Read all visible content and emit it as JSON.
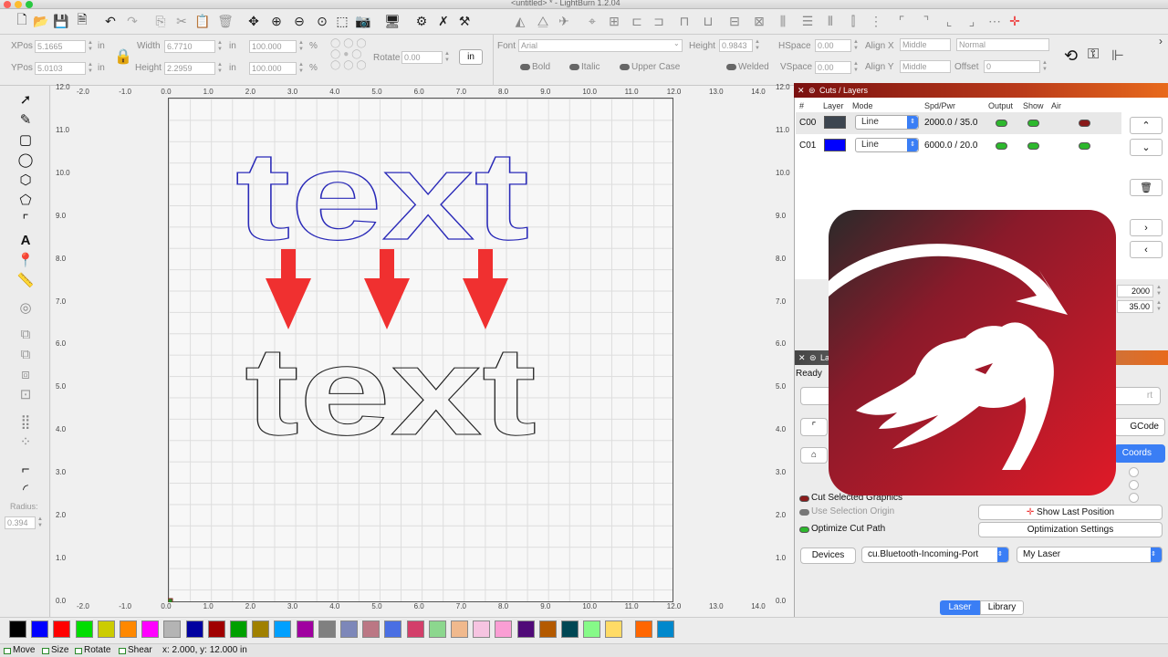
{
  "window": {
    "title": "<untitled> * - LightBurn 1.2.04"
  },
  "toolbar2": {
    "xpos_label": "XPos",
    "xpos_value": "5.1665",
    "ypos_label": "YPos",
    "ypos_value": "5.0103",
    "unit": "in",
    "width_label": "Width",
    "width_value": "6.7710",
    "height_label": "Height",
    "height_value": "2.2959",
    "pct1": "100.000",
    "pct2": "100.000",
    "pct_sign": "%",
    "rotate_label": "Rotate",
    "rotate_value": "0.00",
    "unit_button": "in",
    "font_label": "Font",
    "font_value": "Arial",
    "fheight_label": "Height",
    "fheight_value": "0.9843",
    "hspace_label": "HSpace",
    "hspace_value": "0.00",
    "vspace_label": "VSpace",
    "vspace_value": "0.00",
    "alignx_label": "Align X",
    "alignx_value": "Middle",
    "aligny_label": "Align Y",
    "aligny_value": "Middle",
    "normal_value": "Normal",
    "offset_label": "Offset",
    "offset_value": "0",
    "bold_label": "Bold",
    "italic_label": "Italic",
    "upper_label": "Upper Case",
    "welded_label": "Welded"
  },
  "rulers": {
    "top": [
      "-2.0",
      "-1.0",
      "0.0",
      "1.0",
      "2.0",
      "3.0",
      "4.0",
      "5.0",
      "6.0",
      "7.0",
      "8.0",
      "9.0",
      "10.0",
      "11.0",
      "12.0",
      "13.0",
      "14.0"
    ],
    "left": [
      "12.0",
      "11.0",
      "10.0",
      "9.0",
      "8.0",
      "7.0",
      "6.0",
      "5.0",
      "4.0",
      "3.0",
      "2.0",
      "1.0",
      "0.0"
    ]
  },
  "canvas": {
    "text_top": "text",
    "text_bottom": "text"
  },
  "left_toolbar": {
    "radius_label": "Radius:",
    "radius_value": "0.394"
  },
  "cuts": {
    "panel_title": "Cuts / Layers",
    "headers": [
      "#",
      "Layer",
      "Mode",
      "Spd/Pwr",
      "Output",
      "Show",
      "Air"
    ],
    "rows": [
      {
        "id": "C00",
        "color": "#3d4650",
        "mode": "Line",
        "spdpwr": "2000.0 / 35.0"
      },
      {
        "id": "C01",
        "color": "#0000ff",
        "mode": "Line",
        "spdpwr": "6000.0 / 20.0"
      }
    ],
    "speed_value": "2000",
    "power_value": "35.00"
  },
  "laser": {
    "panel_title": "La",
    "status": "Ready",
    "start_partial": "rt",
    "gcode_partial": "GCode",
    "coords_partial": "Coords",
    "cut_selected": "Cut Selected Graphics",
    "use_origin": "Use Selection Origin",
    "optimize": "Optimize Cut Path",
    "show_last": "Show Last Position",
    "opt_settings": "Optimization Settings",
    "devices": "Devices",
    "port": "cu.Bluetooth-Incoming-Port",
    "laser_name": "My Laser",
    "tab_laser": "Laser",
    "tab_library": "Library"
  },
  "palette": [
    "#000000",
    "#0000ff",
    "#ff0000",
    "#00dd00",
    "#cccc00",
    "#ff8800",
    "#ff00ff",
    "#b4b4b4",
    "#0000a0",
    "#a00000",
    "#00a000",
    "#a08000",
    "#00a0ff",
    "#a000a0",
    "#808080",
    "#7d87b9",
    "#bb7784",
    "#4a6fe3",
    "#d33f6a",
    "#8cd78e",
    "#f0b98d",
    "#f6c4e1",
    "#fa9ed4",
    "#500a78",
    "#b45a00",
    "#004754",
    "#86fa88",
    "#ffdb66",
    "#ff6600",
    "#0088cc"
  ],
  "status": {
    "move": "Move",
    "size": "Size",
    "rotate": "Rotate",
    "shear": "Shear",
    "coords": "x: 2.000, y: 12.000 in"
  }
}
